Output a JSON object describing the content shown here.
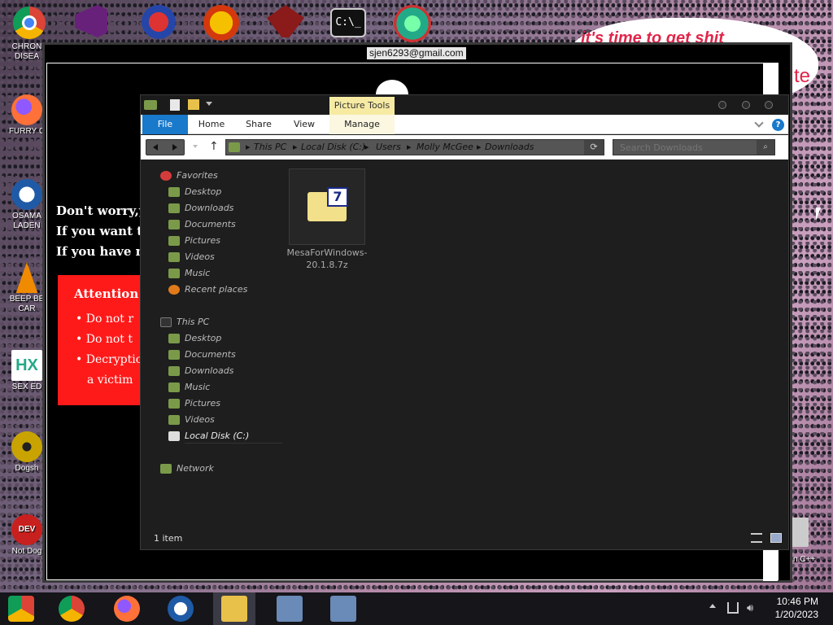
{
  "desktop": {
    "icons": [
      {
        "label": "CHRON DISEA"
      },
      {
        "label": "FURRY C"
      },
      {
        "label": "OSAMA LADEN"
      },
      {
        "label": "BEEP BE CAR"
      },
      {
        "label": "SEX ED"
      },
      {
        "label": "Dogsh"
      },
      {
        "label": "Not Dog"
      }
    ],
    "right_labels": {
      "cpp": "n C++",
      "banner": "it's time to get shit",
      "banner2": "te"
    }
  },
  "ransom_window": {
    "email": "sjen6293@gmail.com",
    "lines": [
      "Don't worry,yo",
      "If you want to",
      "If you have no"
    ],
    "attention": {
      "title": "Attention!",
      "items": [
        "Do not r",
        "Do not t",
        "Decryptio",
        "a victim"
      ]
    }
  },
  "explorer": {
    "picture_tools_label": "Picture Tools",
    "tabs": {
      "file": "File",
      "home": "Home",
      "share": "Share",
      "view": "View",
      "manage": "Manage"
    },
    "breadcrumbs": [
      "This PC",
      "Local Disk (C:)",
      "Users",
      "Molly McGee",
      "Downloads"
    ],
    "search_placeholder": "Search Downloads",
    "nav": {
      "favorites_header": "Favorites",
      "favorites": [
        "Desktop",
        "Downloads",
        "Documents",
        "Pictures",
        "Videos",
        "Music",
        "Recent places"
      ],
      "thispc_header": "This PC",
      "thispc": [
        "Desktop",
        "Documents",
        "Downloads",
        "Music",
        "Pictures",
        "Videos",
        "Local Disk (C:)"
      ],
      "network": "Network"
    },
    "file": {
      "name": "MesaForWindows-20.1.8.7z",
      "badge": "7"
    },
    "status": "1 item",
    "accent": "#1979ca"
  },
  "taskbar": {
    "time": "10:46 PM",
    "date": "1/20/2023"
  }
}
